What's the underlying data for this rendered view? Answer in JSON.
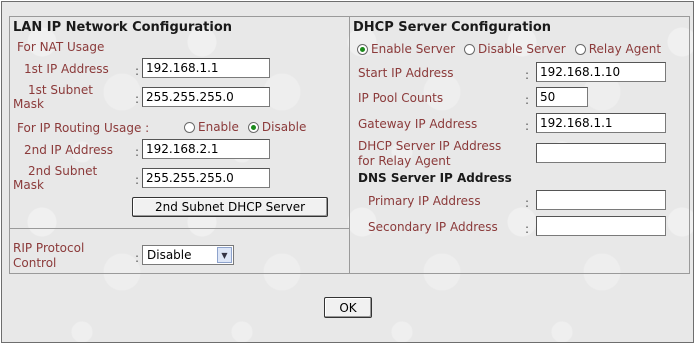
{
  "lan": {
    "title": "LAN IP Network Configuration",
    "nat_usage_label": "For NAT Usage",
    "ip1_label": "1st IP Address",
    "ip1_value": "192.168.1.1",
    "mask1_label_line1": "1st Subnet",
    "mask1_label_line2": "Mask",
    "mask1_value": "255.255.255.0",
    "routing_label": "For IP Routing Usage :",
    "routing_enable": "Enable",
    "routing_disable": "Disable",
    "routing_selected": "Disable",
    "ip2_label": "2nd IP Address",
    "ip2_value": "192.168.2.1",
    "mask2_label_line1": "2nd Subnet",
    "mask2_label_line2": "Mask",
    "mask2_value": "255.255.255.0",
    "subnet_dhcp_button": "2nd Subnet DHCP Server",
    "rip_label_line1": "RIP Protocol",
    "rip_label_line2": "Control",
    "rip_value": "Disable",
    "colon": ":"
  },
  "dhcp": {
    "title": "DHCP Server Configuration",
    "mode_enable": "Enable Server",
    "mode_disable": "Disable Server",
    "mode_relay": "Relay Agent",
    "mode_selected": "Enable Server",
    "start_ip_label": "Start IP Address",
    "start_ip_value": "192.168.1.10",
    "pool_label": "IP Pool Counts",
    "pool_value": "50",
    "gateway_label": "Gateway IP Address",
    "gateway_value": "192.168.1.1",
    "relay_label_line1": "DHCP Server IP Address",
    "relay_label_line2": "for Relay Agent",
    "relay_value": "",
    "dns_title": "DNS Server IP Address",
    "primary_dns_label": "Primary IP Address",
    "primary_dns_value": "",
    "secondary_dns_label": "Secondary IP Address",
    "secondary_dns_value": ""
  },
  "footer": {
    "ok_label": "OK"
  }
}
